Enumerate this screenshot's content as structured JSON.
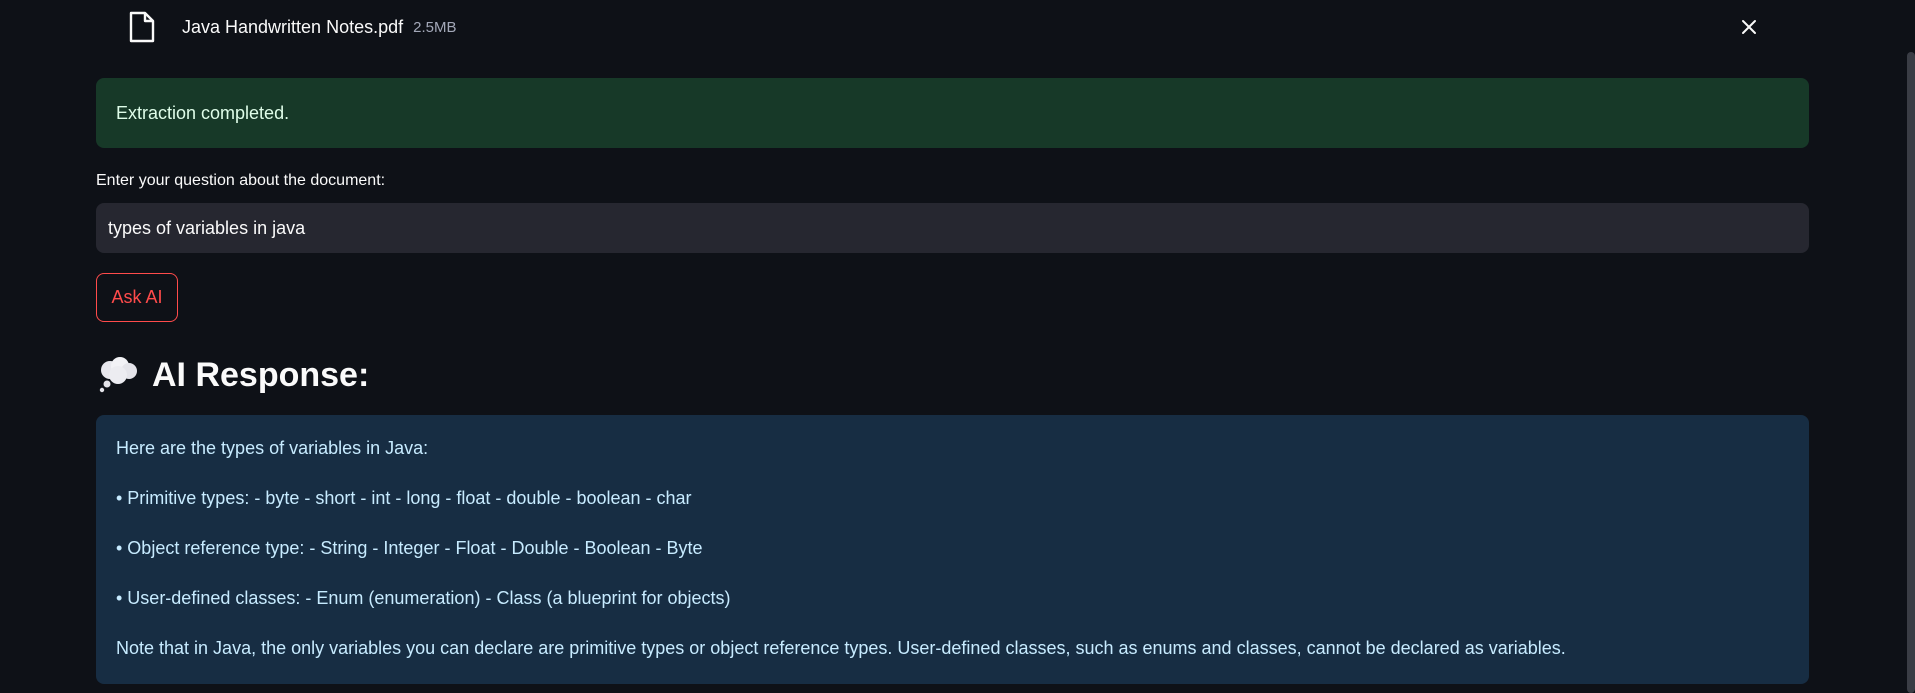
{
  "file": {
    "name": "Java Handwritten Notes.pdf",
    "size": "2.5MB",
    "icon": "file-icon",
    "close_icon": "close-icon"
  },
  "status": {
    "message": "Extraction completed."
  },
  "question": {
    "label": "Enter your question about the document:",
    "value": "types of variables in java"
  },
  "ask_button": {
    "label": "Ask AI"
  },
  "response": {
    "icon": "thought-balloon-icon",
    "heading": "AI Response:",
    "lines": [
      "Here are the types of variables in Java:",
      "• Primitive types: - byte - short - int - long - float - double - boolean - char",
      "• Object reference type: - String - Integer - Float - Double - Boolean - Byte",
      "• User-defined classes: - Enum (enumeration) - Class (a blueprint for objects)",
      "Note that in Java, the only variables you can declare are primitive types or object reference types. User-defined classes, such as enums and classes, cannot be declared as variables."
    ]
  },
  "colors": {
    "background": "#0e1117",
    "success_bg": "#173928",
    "success_text": "#dffde9",
    "input_bg": "#262730",
    "accent": "#ff4b4b",
    "info_bg": "#172d43",
    "info_text": "#c7ebff"
  }
}
